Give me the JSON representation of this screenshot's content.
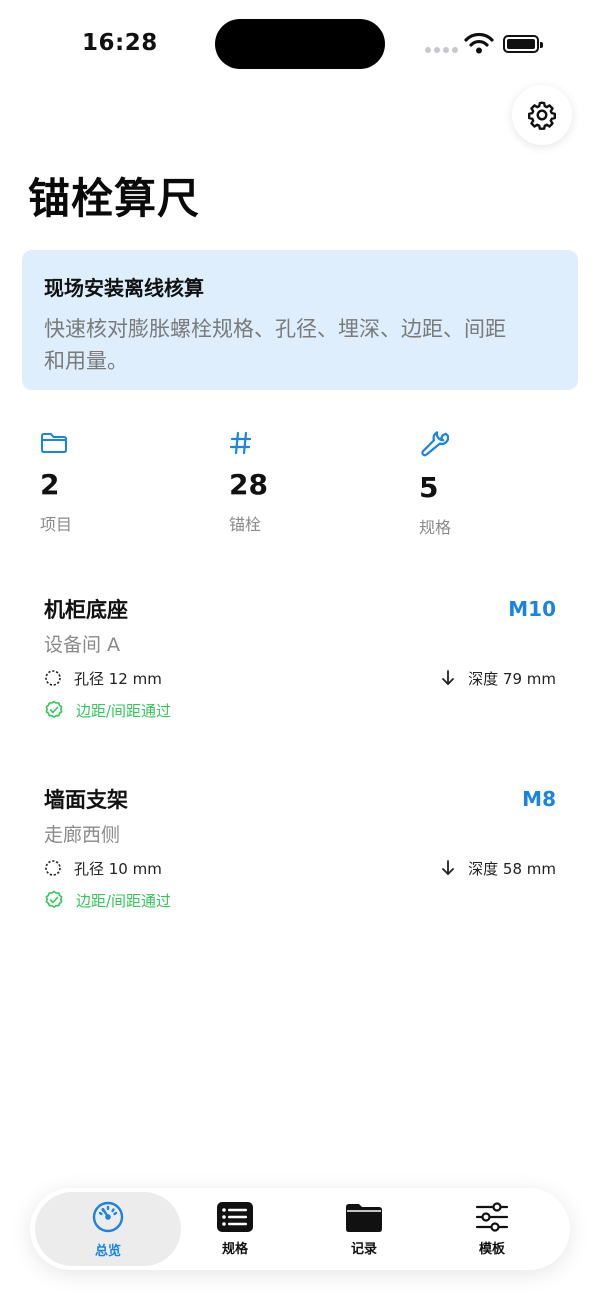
{
  "status_bar": {
    "time": "16:28"
  },
  "header": {
    "title": "锚栓算尺"
  },
  "info_card": {
    "title": "现场安装离线核算",
    "description_line1": "快速核对膨胀螺栓规格、孔径、埋深、边距、间距",
    "description_line2": "和用量。"
  },
  "stats": [
    {
      "icon": "folder-icon",
      "value": "2",
      "label": "项目"
    },
    {
      "icon": "hash-icon",
      "value": "28",
      "label": "锚栓"
    },
    {
      "icon": "wrench-icon",
      "value": "5",
      "label": "规格"
    }
  ],
  "records": [
    {
      "name": "机柜底座",
      "spec": "M10",
      "location": "设备间 A",
      "hole": "孔径 12 mm",
      "depth": "深度 79 mm",
      "status": "边距/间距通过"
    },
    {
      "name": "墙面支架",
      "spec": "M8",
      "location": "走廊西侧",
      "hole": "孔径 10 mm",
      "depth": "深度 58 mm",
      "status": "边距/间距通过"
    }
  ],
  "tab_bar": {
    "tabs": [
      {
        "label": "总览",
        "icon": "gauge-icon",
        "active": true
      },
      {
        "label": "规格",
        "icon": "list-icon",
        "active": false
      },
      {
        "label": "记录",
        "icon": "folder-icon",
        "active": false
      },
      {
        "label": "模板",
        "icon": "sliders-icon",
        "active": false
      }
    ]
  },
  "colors": {
    "accent": "#1a84e0",
    "success": "#34c759",
    "card_bg": "#deeefc",
    "muted": "#8a8a8a"
  }
}
